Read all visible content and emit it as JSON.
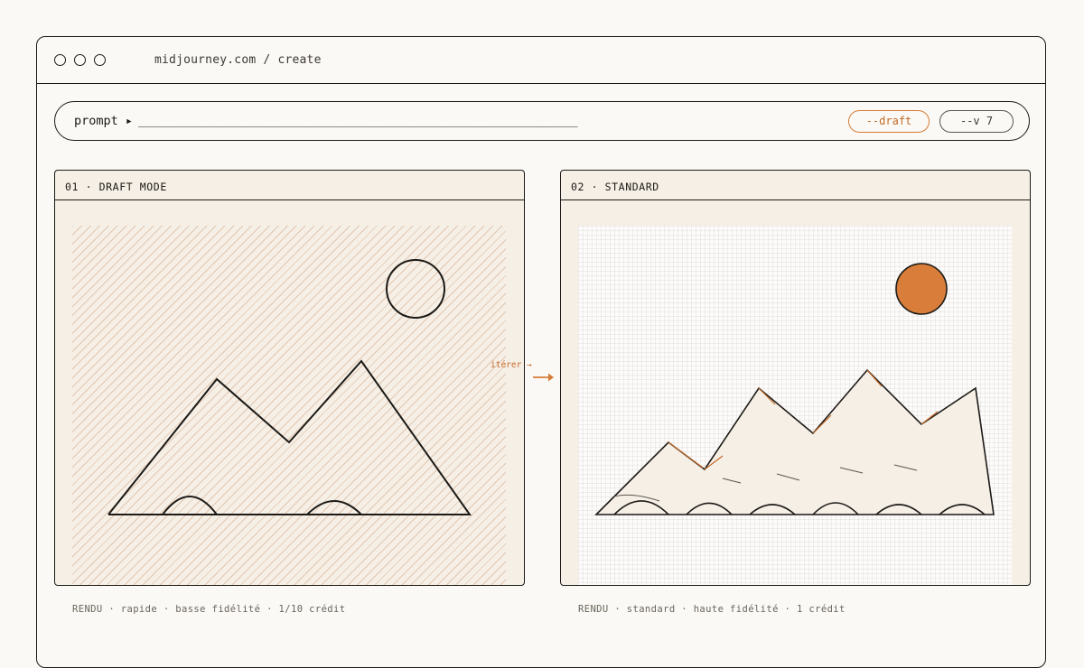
{
  "window": {
    "url": "midjourney.com / create"
  },
  "prompt": {
    "label": "prompt ▸",
    "value": "____________________________________________________________",
    "chips": {
      "draft": "--draft",
      "version": "--v 7"
    }
  },
  "panels": {
    "left": {
      "title": "01 · DRAFT MODE",
      "caption": "RENDU · rapide · basse fidélité · 1/10 crédit"
    },
    "right": {
      "title": "02 · STANDARD",
      "caption": "RENDU · standard · haute fidélité · 1 crédit"
    }
  },
  "iterate": {
    "label": "itérer →"
  },
  "colors": {
    "accent": "#d47c38",
    "ink": "#1c1a17",
    "panel_bg": "#f6efe6",
    "page_bg": "#fbf9f5"
  },
  "icons": [
    "window-dot-icon",
    "mountain-sun-icon",
    "arrow-right-icon"
  ]
}
